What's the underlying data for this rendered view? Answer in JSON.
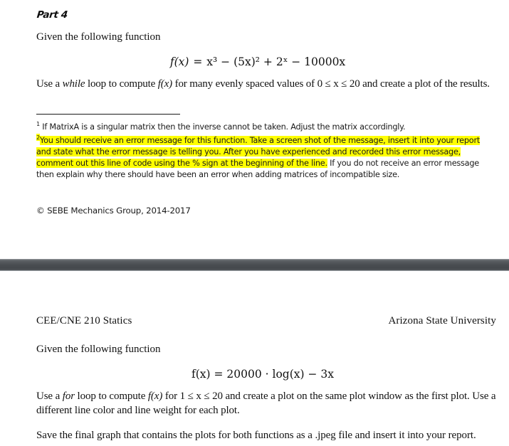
{
  "document": {
    "page_one": {
      "section_heading": "Part 4",
      "intro_paragraph": "Given the following function",
      "equation": {
        "lhs_fn": "f",
        "lhs_arg": "(x)",
        "equals": "=",
        "terms": "x³ − (5x)² + 2ˣ − 10000x",
        "plain": "f(x) = x³ − (5x)² + 2ˣ − 10000x"
      },
      "instruction_prefix": "Use a ",
      "instruction_italic": "while",
      "instruction_mid": " loop to compute ",
      "instruction_italic2": "f(x)",
      "instruction_suffix": " for many evenly spaced values of 0 ≤ x ≤ 20 and create a plot of the results."
    },
    "footnotes": {
      "rule_visible": true,
      "items": [
        {
          "marker": "1",
          "text": "If MatrixA is a singular matrix then the inverse cannot be taken.  Adjust the matrix accordingly.",
          "highlighted": false
        },
        {
          "marker": "2",
          "highlighted_text": "You should receive an error message for this function.  Take a screen shot of the message, insert it into your report and state what the error message is telling you.  After you have experienced and recorded this error message, comment out this line of code using the % sign at the beginning of the line.",
          "plain_text": " If you do not receive an error message then explain why there should have been an error when adding matrices of incompatible size.",
          "highlighted": true
        }
      ]
    },
    "copyright": "© SEBE Mechanics Group, 2014-2017",
    "page_two": {
      "header_left": "CEE/CNE 210 Statics",
      "header_right": "Arizona State University",
      "intro_paragraph": "Given the following function",
      "equation": {
        "plain": "f(x) = 20000 · log(x) − 3x",
        "coefficient": "20000",
        "dot": "·",
        "log": "log",
        "log_arg": "(x)",
        "minus": "−",
        "last_term": "3x"
      },
      "instruction_prefix": "Use a ",
      "instruction_italic": "for",
      "instruction_mid": " loop to compute ",
      "instruction_italic2": "f(x)",
      "instruction_suffix": " for 1 ≤ x ≤ 20 and create a plot on the same plot window as the first plot. Use a different line color and line weight for each plot.",
      "save_paragraph": "Save the final graph that contains the plots for both functions as a .jpeg file and insert it into your report."
    }
  },
  "colors": {
    "highlight": "#ffff00",
    "text": "#111111",
    "separator_band": "#4a4e52",
    "page_background": "#ffffff"
  }
}
